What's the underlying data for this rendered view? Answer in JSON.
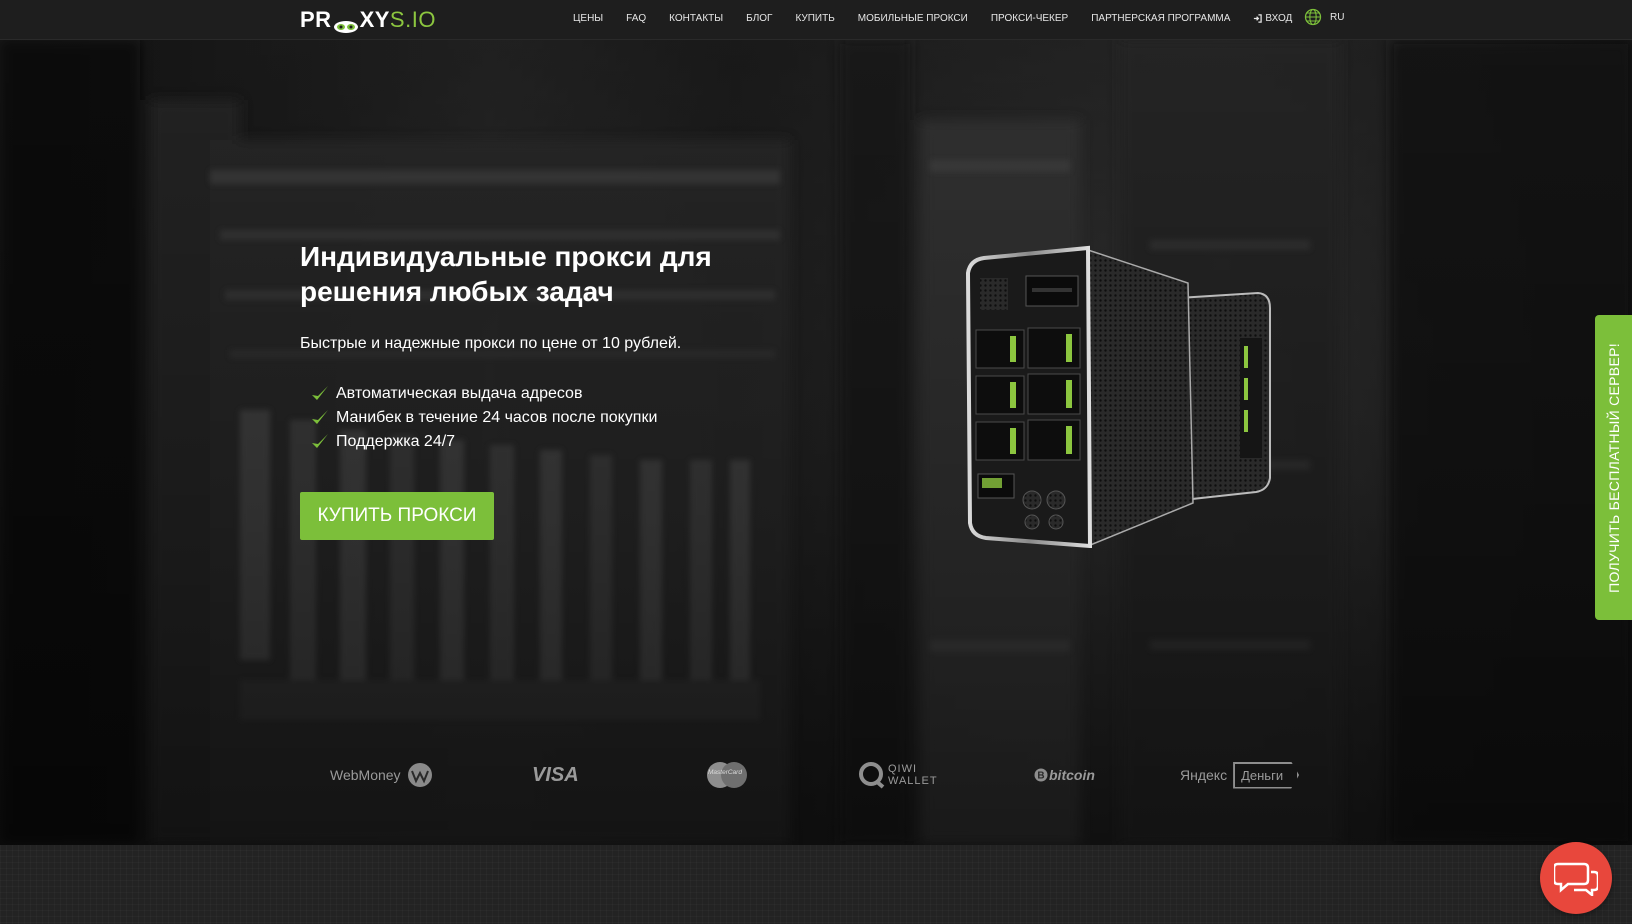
{
  "logo": {
    "bold": "PR",
    "bold2": "XY",
    "thin": "S.IO"
  },
  "nav": {
    "items": [
      "ЦЕНЫ",
      "FAQ",
      "КОНТАКТЫ",
      "БЛОГ",
      "КУПИТЬ",
      "МОБИЛЬНЫЕ ПРОКСИ",
      "ПРОКСИ-ЧЕКЕР",
      "ПАРТНЕРСКАЯ ПРОГРАММА"
    ],
    "login": "ВХОД",
    "login_icon": "sign-in-icon",
    "lang": "RU",
    "lang_icon": "globe-icon"
  },
  "hero": {
    "title": "Индивидуальные прокси для решения любых задач",
    "subtitle": "Быстрые и надежные прокси по цене от 10 рублей.",
    "features": [
      "Автоматическая выдача адресов",
      "Манибек в течение 24 часов после покупки",
      "Поддержка 24/7"
    ],
    "buy_button": "КУПИТЬ ПРОКСИ"
  },
  "payments": {
    "webmoney": "WebMoney",
    "visa": "VISA",
    "mastercard": "MasterCard",
    "qiwi_1": "QIWI",
    "qiwi_2": "WALLET",
    "bitcoin": "bitcoin",
    "yandex_1": "Яндекс",
    "yandex_2": "Деньги"
  },
  "side_tab": "ПОЛУЧИТЬ БЕСПЛАТНЫЙ СЕРВЕР!",
  "chat_icon": "chat-bubbles-icon",
  "colors": {
    "accent": "#7cbf3a",
    "chat": "#e8473c",
    "header": "#1e1e1e"
  }
}
